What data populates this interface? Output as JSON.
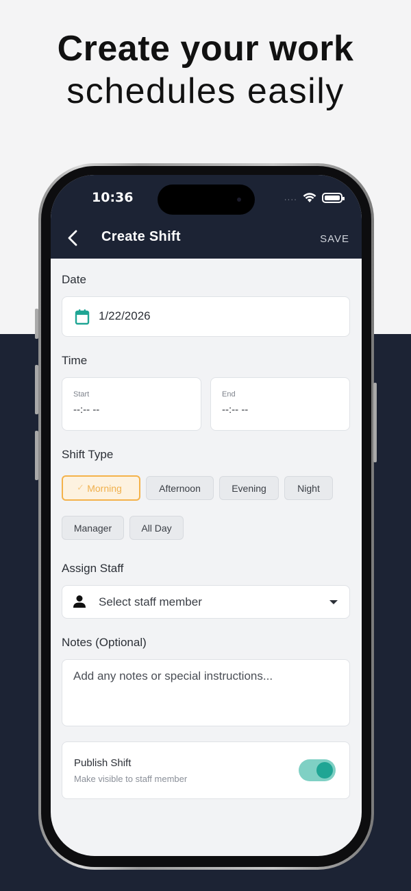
{
  "headline": {
    "line1": "Create your work",
    "line2": "schedules easily"
  },
  "status_bar": {
    "time": "10:36",
    "dots": "....",
    "icons": [
      "wifi-icon",
      "battery-icon"
    ]
  },
  "nav": {
    "title": "Create Shift",
    "save_label": "SAVE",
    "back_icon": "chevron-left-icon"
  },
  "form": {
    "date": {
      "label": "Date",
      "value": "1/22/2026",
      "icon": "calendar-icon"
    },
    "time": {
      "label": "Time",
      "start": {
        "label": "Start",
        "value": "--:-- --"
      },
      "end": {
        "label": "End",
        "value": "--:-- --"
      }
    },
    "shift_type": {
      "label": "Shift Type",
      "options": [
        "Morning",
        "Afternoon",
        "Evening",
        "Night",
        "Manager",
        "All Day"
      ],
      "selected": "Morning",
      "selected_check": "✓"
    },
    "assign_staff": {
      "label": "Assign Staff",
      "placeholder": "Select staff member",
      "icon": "person-icon"
    },
    "notes": {
      "label": "Notes (Optional)",
      "placeholder": "Add any notes or special instructions..."
    },
    "publish": {
      "title": "Publish Shift",
      "subtitle": "Make visible to staff member",
      "enabled": true
    }
  },
  "colors": {
    "navy": "#1c2334",
    "accent_teal": "#1fa594",
    "selected_orange": "#f4b24a"
  }
}
